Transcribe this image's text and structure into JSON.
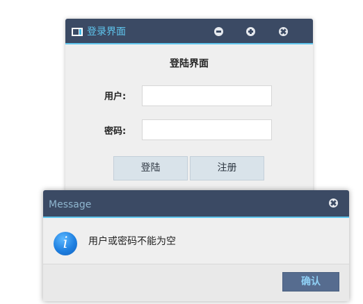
{
  "login_window": {
    "title": "登录界面",
    "heading": "登陆界面",
    "username_label": "用户:",
    "username_value": "",
    "password_label": "密码:",
    "password_value": "",
    "login_button": "登陆",
    "register_button": "注册"
  },
  "message_dialog": {
    "title": "Message",
    "text": "用户或密码不能为空",
    "confirm_button": "确认",
    "icon": "info-icon"
  },
  "colors": {
    "titlebar": "#3b4a64",
    "accent": "#5fc6ee",
    "button_bg": "#d9e3ea",
    "confirm_bg": "#566c8f"
  }
}
